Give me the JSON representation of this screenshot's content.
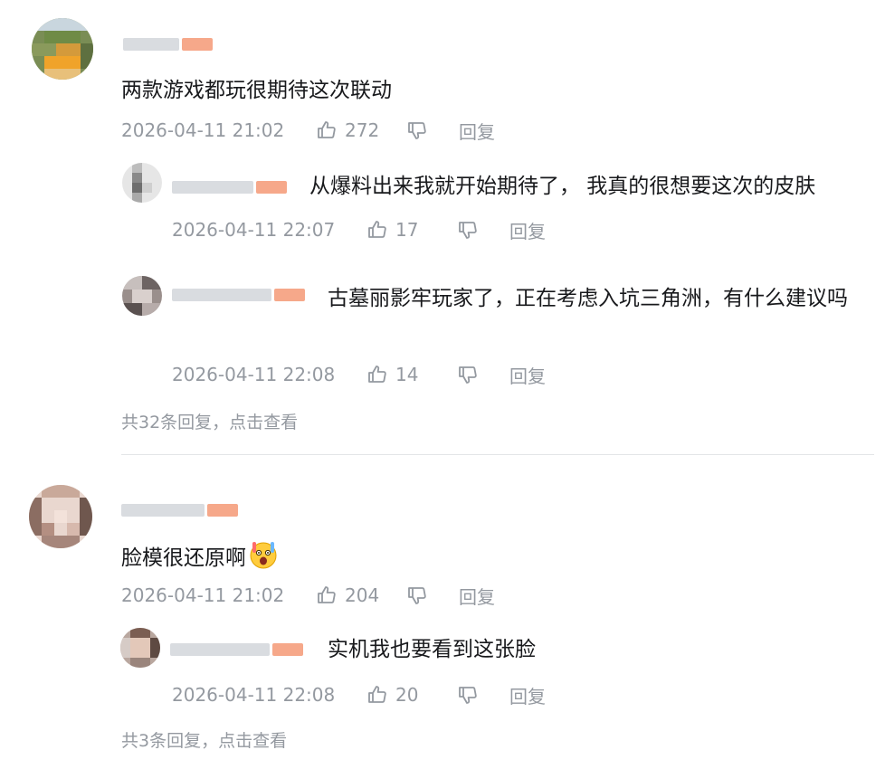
{
  "comments": [
    {
      "text": "两款游戏都玩很期待这次联动",
      "time": "2026-04-11 21:02",
      "likes": "272",
      "reply_label": "回复",
      "replies": [
        {
          "text": "从爆料出来我就开始期待了， 我真的很想要这次的皮肤",
          "time": "2026-04-11 22:07",
          "likes": "17",
          "reply_label": "回复"
        },
        {
          "text": "古墓丽影牢玩家了，正在考虑入坑三角洲，有什么建议吗",
          "time": "2026-04-11 22:08",
          "likes": "14",
          "reply_label": "回复"
        }
      ],
      "more_replies": "共32条回复，点击查看"
    },
    {
      "text": "脸模很还原啊",
      "time": "2026-04-11 21:02",
      "likes": "204",
      "reply_label": "回复",
      "replies": [
        {
          "text": "实机我也要看到这张脸",
          "time": "2026-04-11 22:08",
          "likes": "20",
          "reply_label": "回复"
        }
      ],
      "more_replies": "共3条回复，点击查看"
    }
  ],
  "icons": {
    "like": "thumbs-up-icon",
    "dislike": "thumbs-down-icon",
    "emoji": "shocked-emoji-icon"
  },
  "colors": {
    "text": "#18191c",
    "meta": "#9499a0",
    "tag": "#f6a88a",
    "divider": "#e3e5e7"
  }
}
